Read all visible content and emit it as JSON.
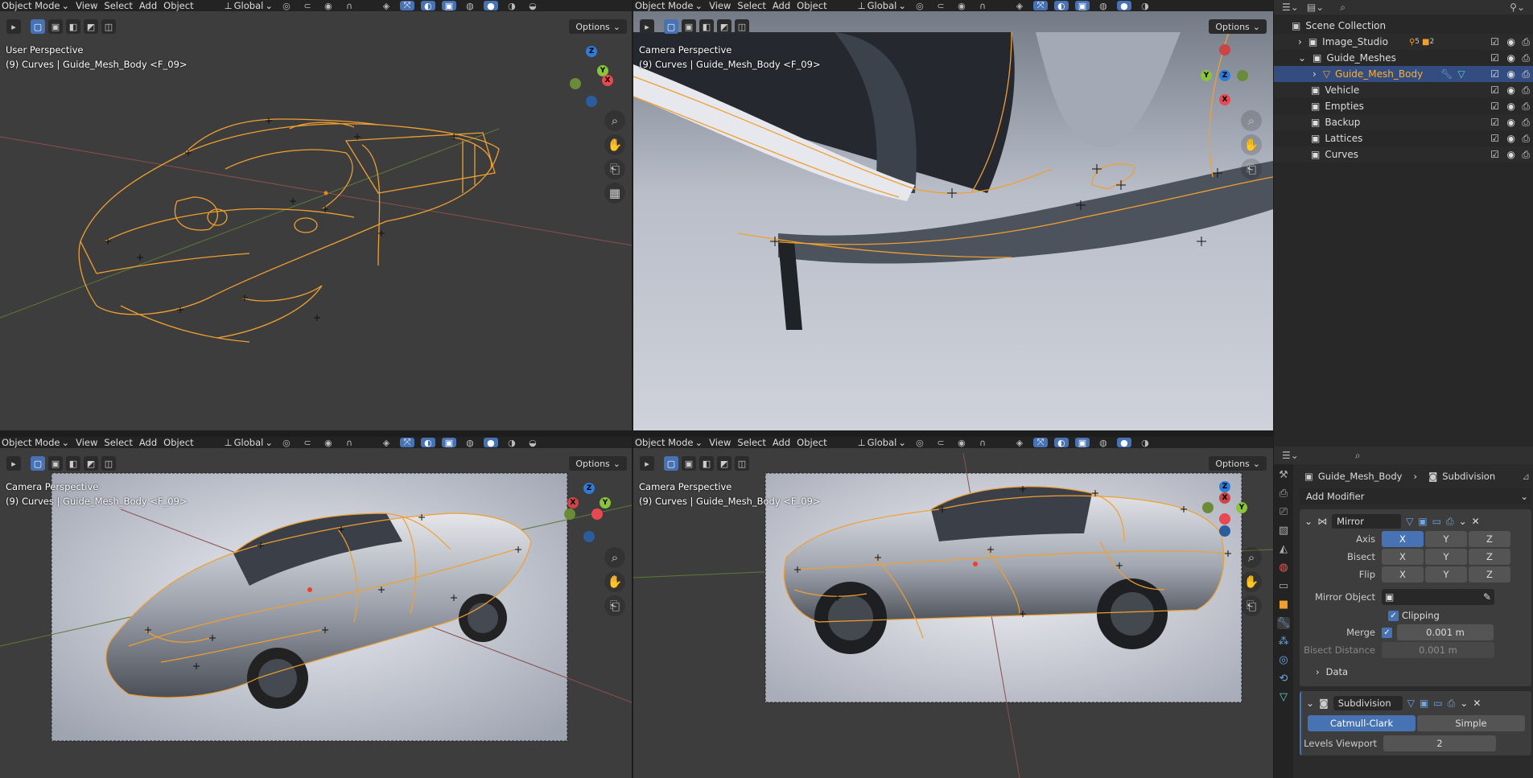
{
  "viewports": [
    {
      "mode": "Object Mode",
      "menus": [
        "View",
        "Select",
        "Add",
        "Object"
      ],
      "orientation": "Global",
      "options": "Options",
      "perspective": "User Perspective",
      "object_info": "(9) Curves | Guide_Mesh_Body <F_09>"
    },
    {
      "mode": "Object Mode",
      "menus": [
        "View",
        "Select",
        "Add",
        "Object"
      ],
      "orientation": "Global",
      "options": "Options",
      "perspective": "Camera Perspective",
      "object_info": "(9) Curves | Guide_Mesh_Body <F_09>"
    },
    {
      "mode": "Object Mode",
      "menus": [
        "View",
        "Select",
        "Add",
        "Object"
      ],
      "orientation": "Global",
      "options": "Options",
      "perspective": "Camera Perspective",
      "object_info": "(9) Curves | Guide_Mesh_Body <F_09>"
    },
    {
      "mode": "Object Mode",
      "menus": [
        "View",
        "Select",
        "Add",
        "Object"
      ],
      "orientation": "Global",
      "options": "Options",
      "perspective": "Camera Perspective",
      "object_info": "(9) Curves | Guide_Mesh_Body <F_09>"
    }
  ],
  "outliner": {
    "root": "Scene Collection",
    "items": [
      {
        "label": "Image_Studio",
        "badge": "5",
        "badge2": "2"
      },
      {
        "label": "Guide_Meshes"
      },
      {
        "label": "Guide_Mesh_Body"
      },
      {
        "label": "Vehicle"
      },
      {
        "label": "Empties"
      },
      {
        "label": "Backup"
      },
      {
        "label": "Lattices"
      },
      {
        "label": "Curves"
      }
    ]
  },
  "properties": {
    "breadcrumb_object": "Guide_Mesh_Body",
    "breadcrumb_modifier": "Subdivision",
    "add_modifier": "Add Modifier",
    "mirror": {
      "name": "Mirror",
      "axis_label": "Axis",
      "bisect_label": "Bisect",
      "flip_label": "Flip",
      "x": "X",
      "y": "Y",
      "z": "Z",
      "mirror_object_label": "Mirror Object",
      "clipping_label": "Clipping",
      "merge_label": "Merge",
      "merge_value": "0.001 m",
      "bisect_distance_label": "Bisect Distance",
      "bisect_distance_value": "0.001 m",
      "data_label": "Data"
    },
    "subdivision": {
      "name": "Subdivision",
      "catmull": "Catmull-Clark",
      "simple": "Simple",
      "levels_viewport_label": "Levels Viewport",
      "levels_viewport_value": "2"
    }
  },
  "axis_letters": {
    "x": "X",
    "y": "Y",
    "z": "Z"
  },
  "colors": {
    "accent": "#4772b3",
    "wire": "#f0a030",
    "x_axis": "#e8484f",
    "y_axis": "#8ac43a",
    "z_axis": "#2f7bd8"
  }
}
